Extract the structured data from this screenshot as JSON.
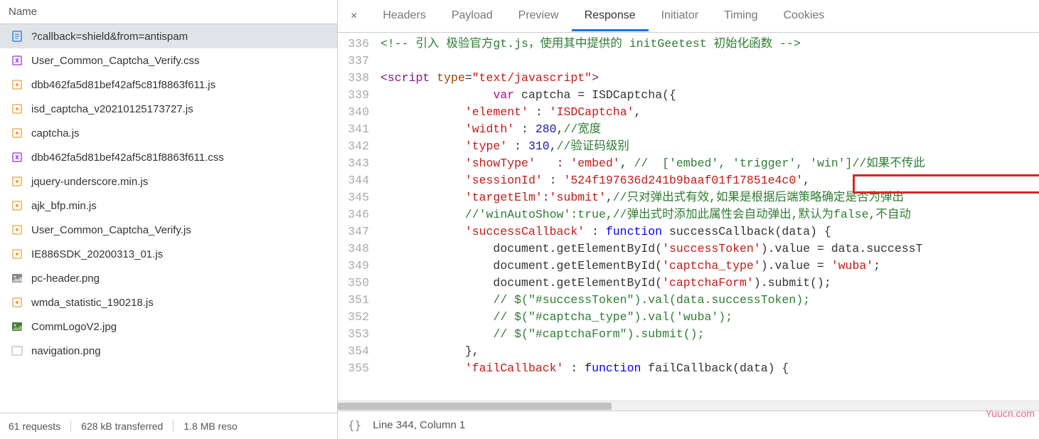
{
  "leftPanel": {
    "headerLabel": "Name",
    "files": [
      {
        "name": "?callback=shield&from=antispam",
        "icon": "doc",
        "selected": true
      },
      {
        "name": "User_Common_Captcha_Verify.css",
        "icon": "css",
        "selected": false
      },
      {
        "name": "dbb462fa5d81bef42af5c81f8863f611.js",
        "icon": "js",
        "selected": false
      },
      {
        "name": "isd_captcha_v20210125173727.js",
        "icon": "js",
        "selected": false
      },
      {
        "name": "captcha.js",
        "icon": "js",
        "selected": false
      },
      {
        "name": "dbb462fa5d81bef42af5c81f8863f611.css",
        "icon": "css",
        "selected": false
      },
      {
        "name": "jquery-underscore.min.js",
        "icon": "js",
        "selected": false
      },
      {
        "name": "ajk_bfp.min.js",
        "icon": "js",
        "selected": false
      },
      {
        "name": "User_Common_Captcha_Verify.js",
        "icon": "js",
        "selected": false
      },
      {
        "name": "IE886SDK_20200313_01.js",
        "icon": "js",
        "selected": false
      },
      {
        "name": "pc-header.png",
        "icon": "img",
        "selected": false
      },
      {
        "name": "wmda_statistic_190218.js",
        "icon": "js",
        "selected": false
      },
      {
        "name": "CommLogoV2.jpg",
        "icon": "imgg",
        "selected": false
      },
      {
        "name": "navigation.png",
        "icon": "img-blank",
        "selected": false
      }
    ],
    "footer": {
      "requests": "61 requests",
      "transferred": "628 kB transferred",
      "resources": "1.8 MB reso"
    }
  },
  "rightPanel": {
    "tabs": [
      {
        "label": "Headers",
        "active": false
      },
      {
        "label": "Payload",
        "active": false
      },
      {
        "label": "Preview",
        "active": false
      },
      {
        "label": "Response",
        "active": true
      },
      {
        "label": "Initiator",
        "active": false
      },
      {
        "label": "Timing",
        "active": false
      },
      {
        "label": "Cookies",
        "active": false
      }
    ],
    "code": {
      "startLine": 336,
      "lines": [
        {
          "n": 336,
          "segs": [
            {
              "t": "<!-- 引入 极验官方gt.js，使用其中提供的 initGeetest 初始化函数 -->",
              "c": "c-comment"
            }
          ]
        },
        {
          "n": 337,
          "segs": []
        },
        {
          "n": 338,
          "segs": [
            {
              "t": "<",
              "c": "c-tag"
            },
            {
              "t": "script",
              "c": "c-tag"
            },
            {
              "t": " ",
              "c": ""
            },
            {
              "t": "type",
              "c": "c-attr"
            },
            {
              "t": "=",
              "c": ""
            },
            {
              "t": "\"text/javascript\"",
              "c": "c-str"
            },
            {
              "t": ">",
              "c": "c-tag"
            }
          ]
        },
        {
          "n": 339,
          "segs": [
            {
              "t": "                ",
              "c": ""
            },
            {
              "t": "var",
              "c": "c-kw2"
            },
            {
              "t": " captcha = ISDCaptcha({",
              "c": ""
            }
          ]
        },
        {
          "n": 340,
          "segs": [
            {
              "t": "            ",
              "c": ""
            },
            {
              "t": "'element'",
              "c": "c-str"
            },
            {
              "t": " : ",
              "c": ""
            },
            {
              "t": "'ISDCaptcha'",
              "c": "c-str"
            },
            {
              "t": ",",
              "c": ""
            }
          ]
        },
        {
          "n": 341,
          "segs": [
            {
              "t": "            ",
              "c": ""
            },
            {
              "t": "'width'",
              "c": "c-str"
            },
            {
              "t": " : ",
              "c": ""
            },
            {
              "t": "280",
              "c": "c-num"
            },
            {
              "t": ",",
              "c": ""
            },
            {
              "t": "//宽度",
              "c": "c-comment"
            }
          ]
        },
        {
          "n": 342,
          "segs": [
            {
              "t": "            ",
              "c": ""
            },
            {
              "t": "'type'",
              "c": "c-str"
            },
            {
              "t": " : ",
              "c": ""
            },
            {
              "t": "310",
              "c": "c-num"
            },
            {
              "t": ",",
              "c": ""
            },
            {
              "t": "//验证码级别",
              "c": "c-comment"
            }
          ]
        },
        {
          "n": 343,
          "segs": [
            {
              "t": "            ",
              "c": ""
            },
            {
              "t": "'showType'",
              "c": "c-str"
            },
            {
              "t": "   : ",
              "c": ""
            },
            {
              "t": "'embed'",
              "c": "c-str"
            },
            {
              "t": ", ",
              "c": ""
            },
            {
              "t": "//  ['embed', 'trigger', 'win']//如果不传此",
              "c": "c-comment"
            }
          ]
        },
        {
          "n": 344,
          "segs": [
            {
              "t": "            ",
              "c": ""
            },
            {
              "t": "'sessionId'",
              "c": "c-str"
            },
            {
              "t": " : ",
              "c": ""
            },
            {
              "t": "'524f197636d241b9baaf01f17851e4c0'",
              "c": "c-str"
            },
            {
              "t": ",",
              "c": ""
            }
          ]
        },
        {
          "n": 345,
          "segs": [
            {
              "t": "            ",
              "c": ""
            },
            {
              "t": "'targetElm'",
              "c": "c-str"
            },
            {
              "t": ":",
              "c": ""
            },
            {
              "t": "'submit'",
              "c": "c-str"
            },
            {
              "t": ",",
              "c": ""
            },
            {
              "t": "//只对弹出式有效,如果是根据后端策略确定是否为弹出",
              "c": "c-comment"
            }
          ]
        },
        {
          "n": 346,
          "segs": [
            {
              "t": "            ",
              "c": ""
            },
            {
              "t": "//'winAutoShow':true,//弹出式时添加此属性会自动弹出,默认为false,不自动",
              "c": "c-comment"
            }
          ]
        },
        {
          "n": 347,
          "segs": [
            {
              "t": "            ",
              "c": ""
            },
            {
              "t": "'successCallback'",
              "c": "c-str"
            },
            {
              "t": " : ",
              "c": ""
            },
            {
              "t": "function",
              "c": "c-kw"
            },
            {
              "t": " successCallback(data) {",
              "c": ""
            }
          ]
        },
        {
          "n": 348,
          "segs": [
            {
              "t": "                document.getElementById(",
              "c": ""
            },
            {
              "t": "'successToken'",
              "c": "c-str"
            },
            {
              "t": ").value = data.successT",
              "c": ""
            }
          ]
        },
        {
          "n": 349,
          "segs": [
            {
              "t": "                document.getElementById(",
              "c": ""
            },
            {
              "t": "'captcha_type'",
              "c": "c-str"
            },
            {
              "t": ").value = ",
              "c": ""
            },
            {
              "t": "'wuba'",
              "c": "c-str"
            },
            {
              "t": ";",
              "c": ""
            }
          ]
        },
        {
          "n": 350,
          "segs": [
            {
              "t": "                document.getElementById(",
              "c": ""
            },
            {
              "t": "'captchaForm'",
              "c": "c-str"
            },
            {
              "t": ").submit();",
              "c": ""
            }
          ]
        },
        {
          "n": 351,
          "segs": [
            {
              "t": "                ",
              "c": ""
            },
            {
              "t": "// $(\"#successToken\").val(data.successToken);",
              "c": "c-comment"
            }
          ]
        },
        {
          "n": 352,
          "segs": [
            {
              "t": "                ",
              "c": ""
            },
            {
              "t": "// $(\"#captcha_type\").val('wuba');",
              "c": "c-comment"
            }
          ]
        },
        {
          "n": 353,
          "segs": [
            {
              "t": "                ",
              "c": ""
            },
            {
              "t": "// $(\"#captchaForm\").submit();",
              "c": "c-comment"
            }
          ]
        },
        {
          "n": 354,
          "segs": [
            {
              "t": "            },",
              "c": ""
            }
          ]
        },
        {
          "n": 355,
          "segs": [
            {
              "t": "            ",
              "c": ""
            },
            {
              "t": "'failCallback'",
              "c": "c-str"
            },
            {
              "t": " : ",
              "c": ""
            },
            {
              "t": "function",
              "c": "c-kw"
            },
            {
              "t": " failCallback(data) {",
              "c": ""
            }
          ]
        }
      ]
    },
    "footer": {
      "braces": "{}",
      "position": "Line 344, Column 1"
    }
  },
  "watermark": "Yuucn.com"
}
